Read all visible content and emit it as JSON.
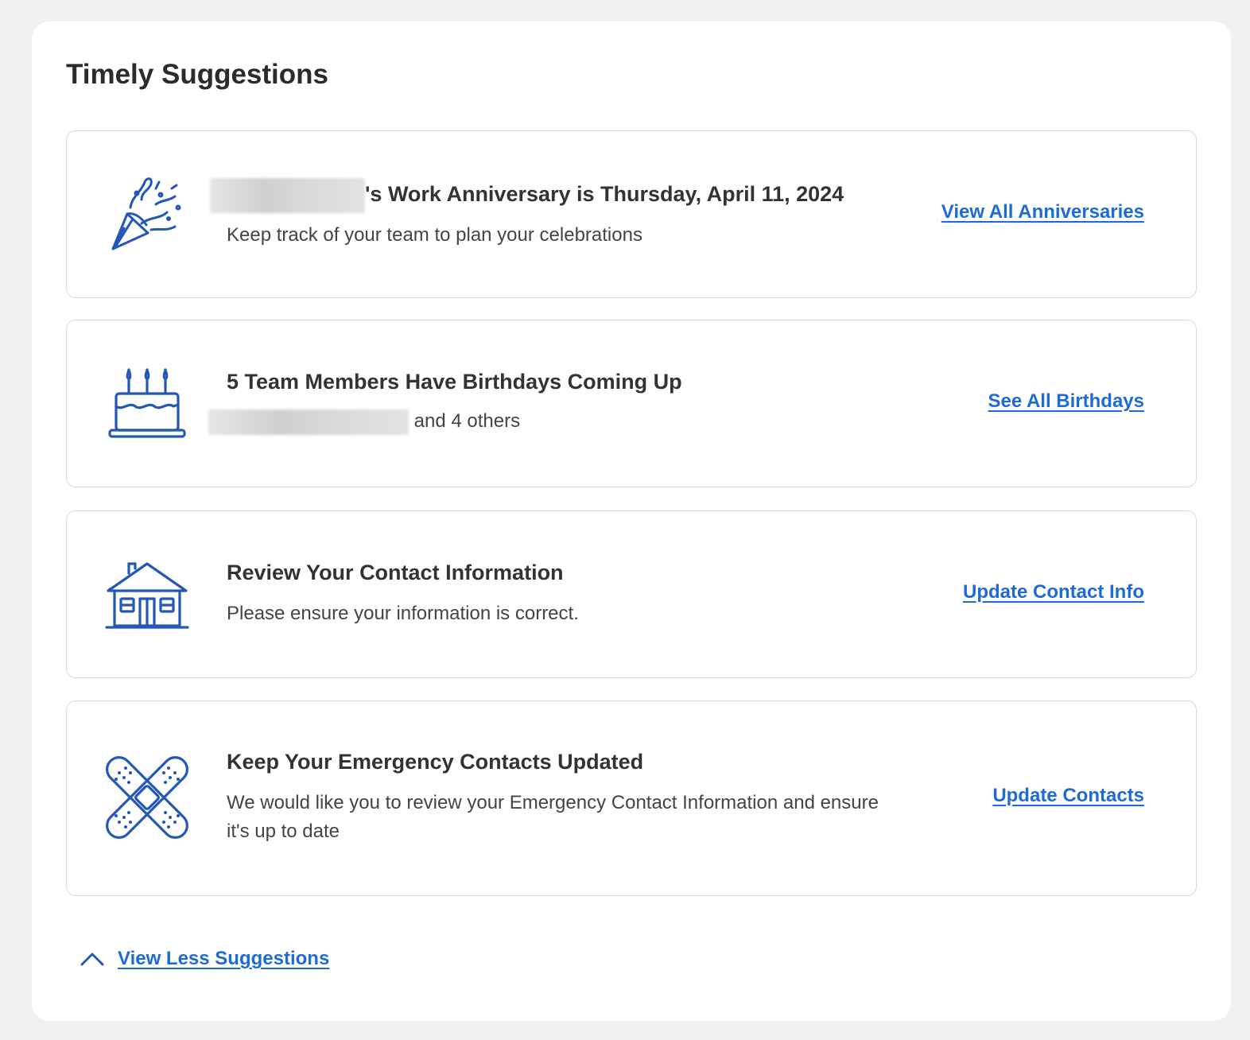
{
  "panel": {
    "title": "Timely Suggestions"
  },
  "cards": [
    {
      "icon": "party-popper-icon",
      "title_suffix": "'s Work Anniversary is Thursday, April 11, 2024",
      "description": "Keep track of your team to plan your celebrations",
      "action_label": "View All Anniversaries"
    },
    {
      "icon": "birthday-cake-icon",
      "title": "5 Team Members Have Birthdays Coming Up",
      "description_suffix": "and 4 others",
      "action_label": "See All Birthdays"
    },
    {
      "icon": "house-icon",
      "title": "Review Your Contact Information",
      "description": "Please ensure your information is correct.",
      "action_label": "Update Contact Info"
    },
    {
      "icon": "bandage-icon",
      "title": "Keep Your Emergency Contacts Updated",
      "description": "We would like you to review your Emergency Contact Information and ensure it's up to date",
      "action_label": "Update Contacts"
    }
  ],
  "footer": {
    "icon": "chevron-up-icon",
    "view_less_label": "View Less Suggestions"
  },
  "colors": {
    "accent": "#1f6bd6",
    "icon_stroke": "#2358b6",
    "background": "#f0f1f3",
    "card_border": "#d7d9dc"
  }
}
